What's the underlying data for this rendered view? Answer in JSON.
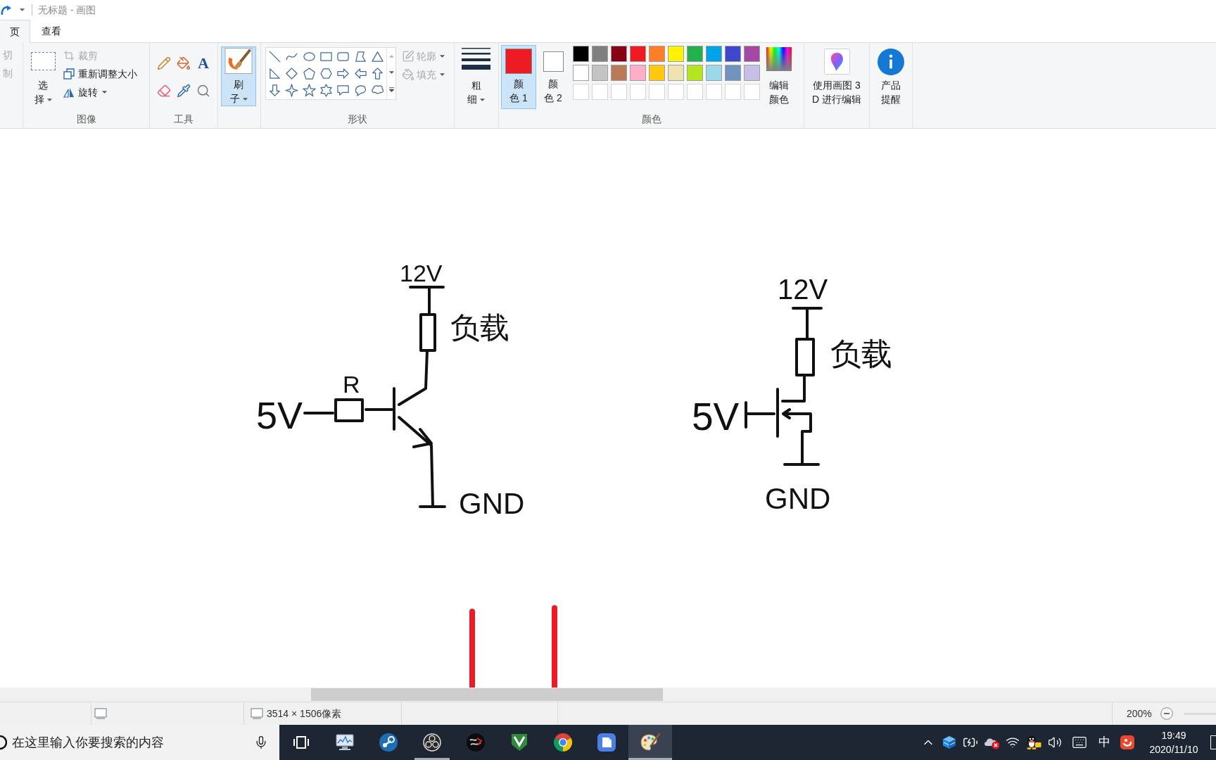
{
  "title_bar": {
    "title": "无标题 - 画图"
  },
  "tabs": [
    {
      "label": "页",
      "selected": true
    },
    {
      "label": "查看",
      "selected": false
    }
  ],
  "ribbon": {
    "clipboard": {
      "items": [
        {
          "label": "切",
          "disabled": true
        },
        {
          "label": "制",
          "disabled": true
        }
      ]
    },
    "image": {
      "label": "图像",
      "select": "选择",
      "items": [
        {
          "kind": "crop",
          "label": "裁剪",
          "disabled": true
        },
        {
          "kind": "resize",
          "label": "重新调整大小",
          "disabled": false
        },
        {
          "kind": "rotate",
          "label": "旋转",
          "disabled": false
        }
      ]
    },
    "tools": {
      "label": "工具",
      "text_tool": "A"
    },
    "brushes": {
      "label": "刷子",
      "selected": true
    },
    "shapes": {
      "label": "形状",
      "options": [
        {
          "kind": "outline",
          "label": "轮廓",
          "disabled": true
        },
        {
          "kind": "fill",
          "label": "填充",
          "disabled": true
        }
      ]
    },
    "size": {
      "label": "粗细"
    },
    "colors": {
      "label": "颜色",
      "current": [
        {
          "label": "颜色 1",
          "color": "#ed1c24",
          "selected": true
        },
        {
          "label": "颜色 2",
          "color": "#ffffff",
          "selected": false
        }
      ],
      "palette": [
        {
          "kind": "color",
          "color": "#000000"
        },
        {
          "kind": "color",
          "color": "#7f7f7f"
        },
        {
          "kind": "color",
          "color": "#880015"
        },
        {
          "kind": "color",
          "color": "#ed1c24"
        },
        {
          "kind": "color",
          "color": "#ff7f27"
        },
        {
          "kind": "color",
          "color": "#fff200"
        },
        {
          "kind": "color",
          "color": "#22b14c"
        },
        {
          "kind": "color",
          "color": "#00a2e8"
        },
        {
          "kind": "color",
          "color": "#3f48cc"
        },
        {
          "kind": "color",
          "color": "#a349a4"
        },
        {
          "kind": "color",
          "color": "#ffffff"
        },
        {
          "kind": "color",
          "color": "#c3c3c3"
        },
        {
          "kind": "color",
          "color": "#b97a57"
        },
        {
          "kind": "color",
          "color": "#ffaec9"
        },
        {
          "kind": "color",
          "color": "#ffc90e"
        },
        {
          "kind": "color",
          "color": "#efe4b0"
        },
        {
          "kind": "color",
          "color": "#b5e61d"
        },
        {
          "kind": "color",
          "color": "#99d9ea"
        },
        {
          "kind": "color",
          "color": "#7092be"
        },
        {
          "kind": "color",
          "color": "#c8bfe7"
        },
        {
          "kind": "empty"
        },
        {
          "kind": "empty"
        },
        {
          "kind": "empty"
        },
        {
          "kind": "empty"
        },
        {
          "kind": "empty"
        },
        {
          "kind": "empty"
        },
        {
          "kind": "empty"
        },
        {
          "kind": "empty"
        },
        {
          "kind": "empty"
        },
        {
          "kind": "empty"
        }
      ],
      "edit": "编辑颜色"
    },
    "paint3d": {
      "label": "使用画图 3D 进行编辑"
    },
    "product_alert": {
      "label": "产品提醒"
    }
  },
  "canvas": {
    "drawings": [
      {
        "kind": "bjt-circuit",
        "supply": "12V",
        "load": "负载",
        "input": "5V",
        "resistor": "R",
        "ground": "GND"
      },
      {
        "kind": "mosfet-circuit",
        "supply": "12V",
        "load": "负载",
        "input": "5V",
        "ground": "GND"
      }
    ]
  },
  "status_bar": {
    "canvas_size": "3514 × 1506像素",
    "zoom": "200%"
  },
  "taskbar": {
    "search": {
      "placeholder": "在这里输入你要搜索的内容"
    },
    "apps": [
      {
        "kind": "task-view",
        "running": false,
        "active": false
      },
      {
        "kind": "monitor-chart",
        "running": false,
        "active": false
      },
      {
        "kind": "round-logo",
        "running": false,
        "active": false
      },
      {
        "kind": "ring-logo",
        "running": true,
        "active": false
      },
      {
        "kind": "round-badge",
        "running": false,
        "active": false
      },
      {
        "kind": "shield-logo",
        "running": false,
        "active": false
      },
      {
        "kind": "browser",
        "running": false,
        "active": false
      },
      {
        "kind": "document-app",
        "running": false,
        "active": false
      },
      {
        "kind": "palette",
        "running": true,
        "active": true
      }
    ],
    "tray": {
      "ime": "中",
      "time": "19:49",
      "date": "2020/11/10"
    }
  }
}
